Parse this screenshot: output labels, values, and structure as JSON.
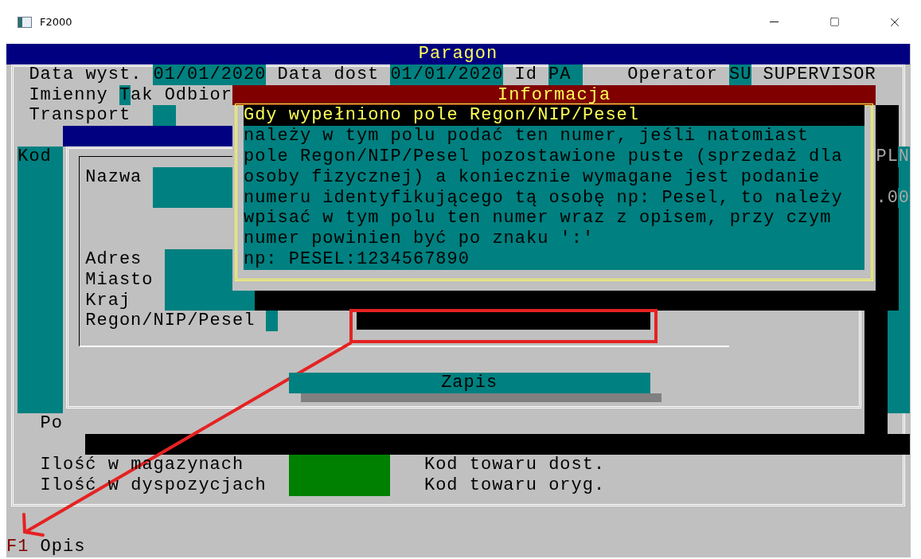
{
  "window": {
    "title": "F2000"
  },
  "form": {
    "title": "Paragon",
    "header": [
      {
        "label": "Data wyst.",
        "value": "01/01/2020"
      },
      {
        "label": "Data dost",
        "value": "01/01/2020"
      },
      {
        "label": "Id",
        "value": "PA"
      },
      {
        "label": "Operator",
        "value": "SU"
      }
    ],
    "operator_name": "SUPERVISOR",
    "named": {
      "label": "Imienny",
      "value": "Tak"
    },
    "recipient_label": "Odbior",
    "transport_label": "Transport",
    "table": {
      "columns": [
        {
          "label": "Kod"
        },
        {
          "label": "PLN"
        }
      ],
      "cell": ".00"
    },
    "recipient_dialog": {
      "labels": [
        {
          "label": "Nazwa"
        },
        {
          "label": "Adres"
        },
        {
          "label": "Miasto"
        },
        {
          "label": "Kraj"
        },
        {
          "label": "Regon/NIP/Pesel"
        }
      ],
      "save_button": "Zapis"
    },
    "po_label": "Po",
    "stock_labels": [
      "Ilość w magazynach",
      "Ilość w dyspozycjach"
    ],
    "code_labels": [
      "Kod towaru dost.",
      "Kod towaru oryg."
    ]
  },
  "info_popup": {
    "title": "Informacja",
    "heading": "Gdy wypełniono pole Regon/NIP/Pesel",
    "lines": [
      "należy w tym polu podać ten numer, jeśli natomiast",
      "pole Regon/NIP/Pesel pozostawione puste (sprzedaż dla",
      "osoby fizycznej) a koniecznie wymagane jest podanie",
      "numeru identyfikującego tą osobę np: Pesel, to należy",
      "wpisać w tym polu ten numer wraz z opisem, przy czym",
      "numer powinien być po znaku ':'",
      "np: PESEL:1234567890"
    ]
  },
  "status_bar": [
    {
      "key": "F1",
      "label": "Opis"
    }
  ]
}
